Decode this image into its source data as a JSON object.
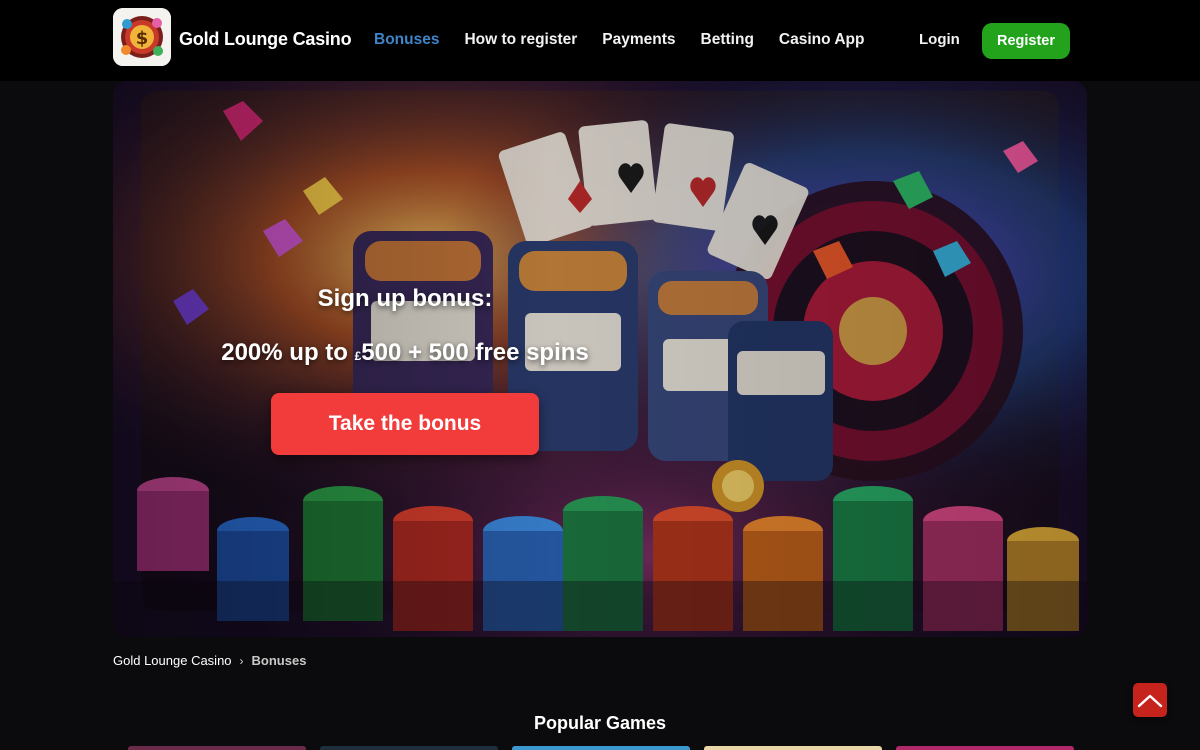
{
  "header": {
    "brand": "Gold Lounge Casino",
    "nav": [
      {
        "label": "Bonuses",
        "active": true
      },
      {
        "label": "How to register",
        "active": false
      },
      {
        "label": "Payments",
        "active": false
      },
      {
        "label": "Betting",
        "active": false
      },
      {
        "label": "Casino App",
        "active": false
      }
    ],
    "login_label": "Login",
    "register_label": "Register"
  },
  "hero": {
    "title": "Sign up bonus:",
    "offer_prefix": "200% up to ",
    "offer_currency": "£",
    "offer_suffix": "500 + 500 free spins",
    "button_label": "Take the bonus"
  },
  "breadcrumb": {
    "home": "Gold Lounge Casino",
    "separator": "›",
    "current": "Bonuses"
  },
  "popular": {
    "title": "Popular Games"
  },
  "colors": {
    "accent_blue": "#3f84c8",
    "register_green": "#22a31b",
    "bonus_red": "#f23b3b",
    "scroll_red": "#c7231d"
  },
  "icons": {
    "logo": "slot-machine-dollar-logo",
    "scroll_top": "chevron-up-icon"
  }
}
